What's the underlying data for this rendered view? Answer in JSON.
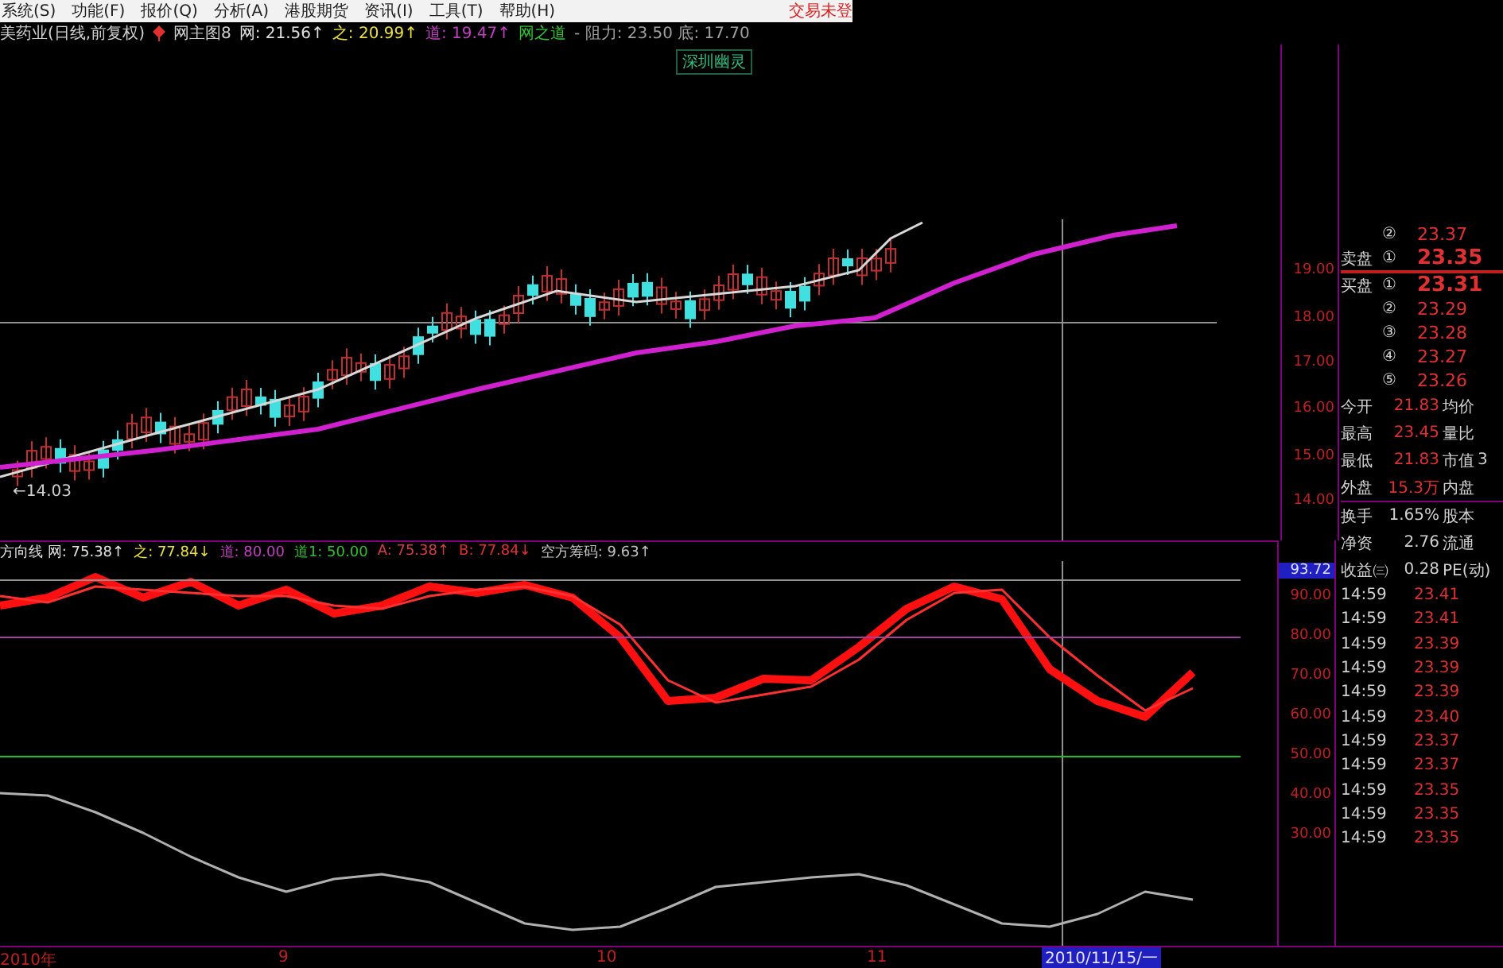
{
  "menu": {
    "items": [
      "系统(S)",
      "功能(F)",
      "报价(Q)",
      "分析(A)",
      "港股期货",
      "资讯(I)",
      "工具(T)",
      "帮助(H)"
    ],
    "status": "交易未登"
  },
  "info_bar": {
    "title": "美药业(日线,前复权)",
    "indicator_name": "网主图8",
    "items": [
      {
        "text": "网: 21.56↑",
        "color": "#e0e0e0"
      },
      {
        "text": "之: 20.99↑",
        "color": "#e8e040"
      },
      {
        "text": "道: 19.47↑",
        "color": "#c040c0"
      },
      {
        "text": "网之道",
        "color": "#30c030"
      },
      {
        "text": "- 阻力: 23.50 底: 17.70",
        "color": "#a0a0a0"
      }
    ]
  },
  "signal_tag": "深圳幽灵",
  "price_chart": {
    "axis_labels": [
      "19.00",
      "18.00",
      "17.00",
      "16.00",
      "15.00",
      "14.00"
    ],
    "low_marker": "←14.03"
  },
  "indicator": {
    "items": [
      {
        "text": "方向线 网: 75.38↑",
        "color": "#e0e0e0"
      },
      {
        "text": "之: 77.84↓",
        "color": "#e8e040"
      },
      {
        "text": "道: 80.00",
        "color": "#c040c0"
      },
      {
        "text": "道1: 50.00",
        "color": "#30c030"
      },
      {
        "text": "A: 75.38↑",
        "color": "#d04040"
      },
      {
        "text": "B: 77.84↓",
        "color": "#e03030"
      },
      {
        "text": "空方筹码: 9.63↑",
        "color": "#c0c0c0"
      }
    ],
    "current_value": "93.72",
    "chart_data": {
      "type": "line",
      "ylim": [
        2,
        99.2
      ],
      "yticks": [
        {
          "value": 90,
          "label": "90.00"
        },
        {
          "value": 80,
          "label": "80.00"
        },
        {
          "value": 70,
          "label": "70.00"
        },
        {
          "value": 60,
          "label": "60.00"
        },
        {
          "value": 50,
          "label": "50.00"
        },
        {
          "value": 40,
          "label": "40.00"
        },
        {
          "value": 30,
          "label": "30.00"
        }
      ],
      "series": [
        {
          "color": "#ff1010",
          "values": [
            88,
            90,
            95.2,
            90,
            94,
            88,
            92,
            86,
            88,
            92.8,
            91.2,
            93.2,
            90,
            80,
            64,
            64.8,
            69.6,
            69.2,
            77.6,
            87.2,
            92.8,
            89.6,
            72,
            64,
            60,
            71.2
          ]
        },
        {
          "color": "#ff3030",
          "values": [
            90.4,
            88.8,
            92.8,
            92,
            91.2,
            90.4,
            90.4,
            88,
            87.2,
            90.4,
            92,
            92.8,
            90.4,
            83.2,
            69.2,
            63.6,
            65.6,
            67.6,
            74.4,
            84.4,
            91.2,
            92,
            80,
            70.4,
            61.6,
            67.2
          ]
        },
        {
          "color": "#909090",
          "values": [
            94.4,
            94.4,
            94.4,
            94.4,
            94.4,
            94.4,
            94.4,
            94.4,
            94.4,
            94.4,
            94.4,
            94.4,
            94.4,
            94.4,
            94.4,
            94.4,
            94.4,
            94.4,
            94.4,
            94.4,
            94.4,
            94.4,
            94.4,
            94.4,
            94.4,
            94.4,
            94.4
          ]
        },
        {
          "color": "#a040a0",
          "values": [
            80,
            80,
            80,
            80,
            80,
            80,
            80,
            80,
            80,
            80,
            80,
            80,
            80,
            80,
            80,
            80,
            80,
            80,
            80,
            80,
            80,
            80,
            80,
            80,
            80,
            80,
            80
          ]
        },
        {
          "color": "#20c020",
          "values": [
            50,
            50,
            50,
            50,
            50,
            50,
            50,
            50,
            50,
            50,
            50,
            50,
            50,
            50,
            50,
            50,
            50,
            50,
            50,
            50,
            50,
            50,
            50,
            50,
            50,
            50,
            50
          ]
        },
        {
          "color": "#b0b0b0",
          "values": [
            40.8,
            40.2,
            36,
            30.8,
            24.8,
            19.6,
            16,
            19.2,
            20.4,
            18.4,
            13.2,
            8,
            6.4,
            7.2,
            12,
            17.2,
            18.4,
            19.6,
            20.4,
            17.6,
            12.8,
            8,
            7.2,
            10.4,
            16,
            14
          ]
        }
      ]
    }
  },
  "order_book": [
    {
      "level": "②",
      "price": "23.37",
      "highlight": false
    },
    {
      "side": "卖盘",
      "level": "①",
      "price": "23.35",
      "highlight": true
    },
    {
      "side": "买盘",
      "level": "①",
      "price": "23.31",
      "highlight": true
    },
    {
      "level": "②",
      "price": "23.29",
      "highlight": false
    },
    {
      "level": "③",
      "price": "23.28",
      "highlight": false
    },
    {
      "level": "④",
      "price": "23.27",
      "highlight": false
    },
    {
      "level": "⑤",
      "price": "23.26",
      "highlight": false
    }
  ],
  "stats": [
    {
      "label": "今开",
      "value": "21.83",
      "label2": "均价",
      "kind": "price"
    },
    {
      "label": "最高",
      "value": "23.45",
      "label2": "量比",
      "kind": "price"
    },
    {
      "label": "最低",
      "value": "21.83",
      "label2": "市值",
      "kind": "price",
      "value2": "3"
    },
    {
      "label": "外盘",
      "value": "15.3万",
      "label2": "内盘",
      "kind": "price"
    },
    {
      "label": "换手",
      "value": "1.65%",
      "label2": "股本",
      "kind": "ratio"
    },
    {
      "label": "净资",
      "value": "2.76",
      "label2": "流通",
      "kind": "ratio"
    },
    {
      "label": "收益㈢",
      "value": "0.28",
      "label2": "PE(动)",
      "kind": "ratio"
    }
  ],
  "ticks": [
    {
      "time": "14:59",
      "price": "23.41"
    },
    {
      "time": "14:59",
      "price": "23.41"
    },
    {
      "time": "14:59",
      "price": "23.39"
    },
    {
      "time": "14:59",
      "price": "23.39"
    },
    {
      "time": "14:59",
      "price": "23.39"
    },
    {
      "time": "14:59",
      "price": "23.40"
    },
    {
      "time": "14:59",
      "price": "23.37"
    },
    {
      "time": "14:59",
      "price": "23.37"
    },
    {
      "time": "14:59",
      "price": "23.35"
    },
    {
      "time": "14:59",
      "price": "23.35"
    },
    {
      "time": "14:59",
      "price": "23.35"
    }
  ],
  "time_axis": {
    "labels": [
      "2010年",
      "9",
      "10",
      "11"
    ],
    "current_date": "2010/11/15/一"
  }
}
